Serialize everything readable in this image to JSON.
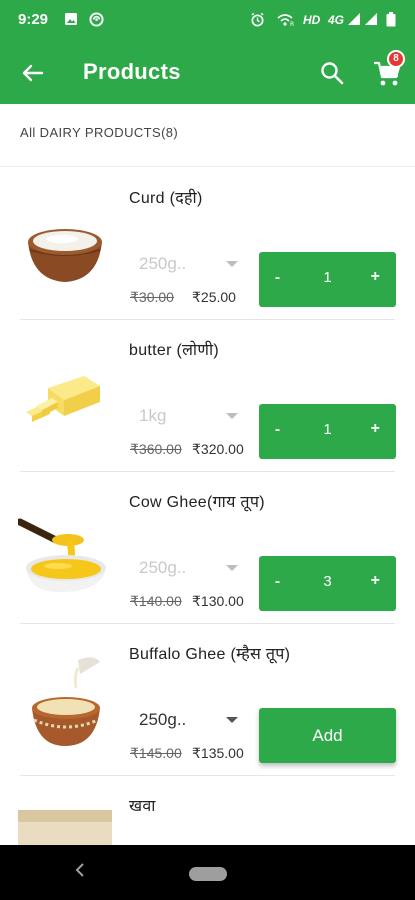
{
  "status_bar": {
    "time": "9:29",
    "network": "HD",
    "signal_type": "4G",
    "icons": [
      "image-icon",
      "sync-icon",
      "alarm-icon",
      "wifi-calling-icon",
      "signal-icon",
      "battery-icon"
    ]
  },
  "app_bar": {
    "title": "Products",
    "cart_count": "8",
    "background": "#2ea94a"
  },
  "section": {
    "title": "All DAIRY PRODUCTS(8)"
  },
  "products": [
    {
      "name": "Curd (दही)",
      "variant": "250g..",
      "mrp": "₹30.00",
      "price": "₹25.00",
      "quantity": "1",
      "minus": "-",
      "plus": "+"
    },
    {
      "name": "butter (लोणी)",
      "variant": "1kg",
      "mrp": "₹360.00",
      "price": "₹320.00",
      "quantity": "1",
      "minus": "-",
      "plus": "+"
    },
    {
      "name": "Cow Ghee(गाय तूप)",
      "variant": "250g..",
      "mrp": "₹140.00",
      "price": "₹130.00",
      "quantity": "3",
      "minus": "-",
      "plus": "+"
    },
    {
      "name": "Buffalo Ghee (म्हैस तूप)",
      "variant": "250g..",
      "mrp": "₹145.00",
      "price": "₹135.00",
      "add_label": "Add"
    },
    {
      "name": "खवा"
    }
  ],
  "colors": {
    "accent": "#2ea94a",
    "badge": "#e53935"
  }
}
